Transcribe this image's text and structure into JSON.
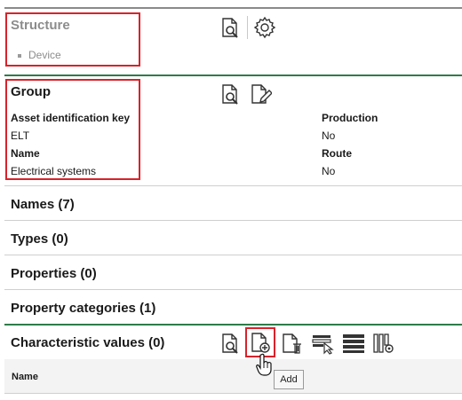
{
  "structure": {
    "title": "Structure",
    "items": [
      "Device"
    ]
  },
  "group": {
    "title": "Group",
    "fields": {
      "asset_key_label": "Asset identification key",
      "asset_key_value": "ELT",
      "name_label": "Name",
      "name_value": "Electrical systems",
      "production_label": "Production",
      "production_value": "No",
      "route_label": "Route",
      "route_value": "No"
    }
  },
  "sections": {
    "names": "Names (7)",
    "types": "Types (0)",
    "properties": "Properties (0)",
    "property_categories": "Property categories (1)",
    "characteristic_values": "Characteristic values (0)"
  },
  "table": {
    "header_name": "Name"
  },
  "tooltip": "Add",
  "icons": {
    "preview": "document-search-icon",
    "settings": "gear-icon",
    "edit": "document-edit-icon",
    "add": "document-add-icon",
    "delete": "document-delete-icon",
    "filter_select": "filter-select-icon",
    "rows": "rows-icon",
    "columns_settings": "columns-settings-icon"
  },
  "colors": {
    "highlight_red": "#d9222a",
    "accent_green": "#2e7d4a"
  }
}
